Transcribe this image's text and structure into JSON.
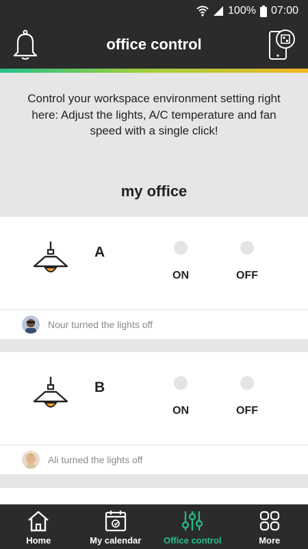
{
  "status_bar": {
    "battery": "100%",
    "time": "07:00"
  },
  "header": {
    "title": "office control",
    "bell_icon": "bell-icon",
    "phone_icon": "phone-qr-icon"
  },
  "intro": {
    "description": "Control your workspace environment setting right here: Adjust the lights, A/C temperature and fan speed with a single click!",
    "section_title": "my office"
  },
  "lights": [
    {
      "name": "A",
      "on_label": "ON",
      "off_label": "OFF",
      "activity": "Nour turned the lights off"
    },
    {
      "name": "B",
      "on_label": "ON",
      "off_label": "OFF",
      "activity": "Ali turned the lights off"
    }
  ],
  "nav": {
    "items": [
      {
        "label": "Home",
        "icon": "home-icon"
      },
      {
        "label": "My calendar",
        "icon": "calendar-icon"
      },
      {
        "label": "Office control",
        "icon": "sliders-icon"
      },
      {
        "label": "More",
        "icon": "grid-icon"
      }
    ],
    "active": "Office control",
    "active_color": "#23c08a"
  },
  "colors": {
    "bar": "#2b2b2b",
    "background": "#e6e6e6",
    "lamp_bulb": "#f3a526"
  }
}
